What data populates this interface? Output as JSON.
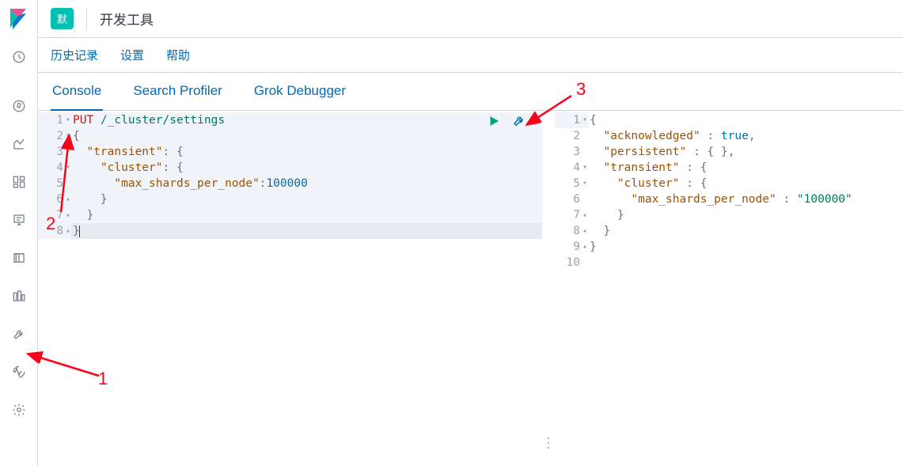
{
  "header": {
    "badge": "默",
    "title": "开发工具"
  },
  "submenu": {
    "history": "历史记录",
    "settings": "设置",
    "help": "帮助"
  },
  "tabs": {
    "console": "Console",
    "profiler": "Search Profiler",
    "grok": "Grok Debugger"
  },
  "request": {
    "method": "PUT",
    "path": "/_cluster/settings",
    "body": {
      "transient": {
        "cluster": {
          "max_shards_per_node": 100000
        }
      }
    },
    "raw_lines": [
      "PUT /_cluster/settings",
      "{",
      "  \"transient\": {",
      "    \"cluster\": {",
      "      \"max_shards_per_node\":100000",
      "    }",
      "  }",
      "}"
    ]
  },
  "response": {
    "acknowledged": true,
    "persistent": {},
    "transient": {
      "cluster": {
        "max_shards_per_node": "100000"
      }
    },
    "raw_lines": [
      "{",
      "  \"acknowledged\" : true,",
      "  \"persistent\" : { },",
      "  \"transient\" : {",
      "    \"cluster\" : {",
      "      \"max_shards_per_node\" : \"100000\"",
      "    }",
      "  }",
      "}",
      ""
    ]
  },
  "annotations": {
    "a1": "1",
    "a2": "2",
    "a3": "3"
  }
}
